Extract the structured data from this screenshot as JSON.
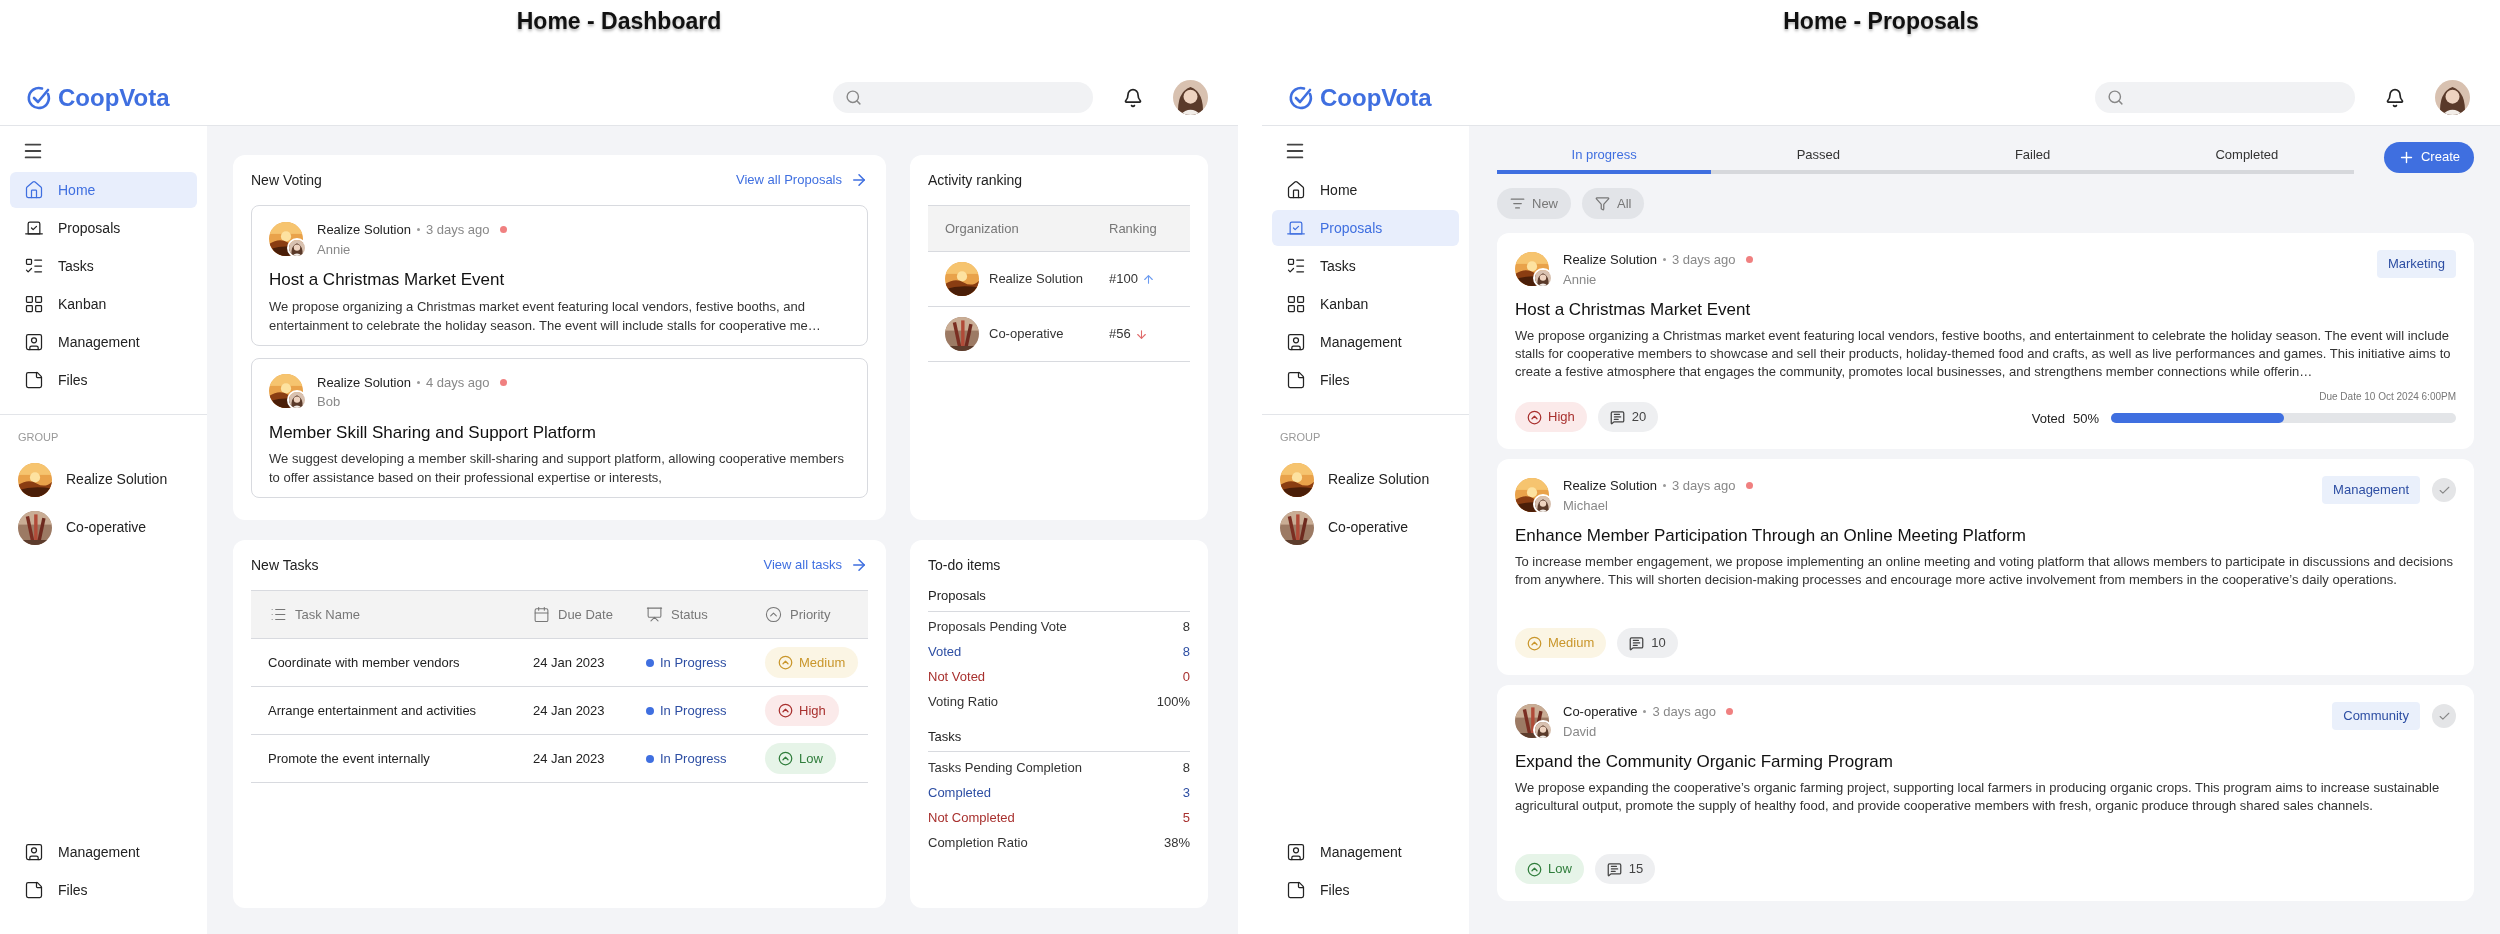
{
  "dashboard": {
    "caption": "Home - Dashboard",
    "brand": "CoopVota",
    "sidebar": {
      "items": [
        {
          "label": "Home",
          "selected": true
        },
        {
          "label": "Proposals",
          "selected": false
        },
        {
          "label": "Tasks",
          "selected": false
        },
        {
          "label": "Kanban",
          "selected": false
        },
        {
          "label": "Management",
          "selected": false
        },
        {
          "label": "Files",
          "selected": false
        }
      ],
      "group_label": "GROUP",
      "groups": [
        {
          "name": "Realize Solution"
        },
        {
          "name": "Co-operative"
        }
      ],
      "bottom_items": [
        {
          "label": "Management"
        },
        {
          "label": "Files"
        }
      ]
    },
    "new_voting": {
      "title": "New Voting",
      "link": "View all Proposals",
      "items": [
        {
          "org": "Realize Solution",
          "time": "3 days ago",
          "unread": true,
          "author": "Annie",
          "title": "Host a Christmas Market Event",
          "body": "We propose organizing a Christmas market event featuring local vendors, festive booths, and entertainment to celebrate the holiday season. The event will include stalls for cooperative me…"
        },
        {
          "org": "Realize Solution",
          "time": "4 days ago",
          "unread": true,
          "author": "Bob",
          "title": "Member Skill Sharing and Support Platform",
          "body": "We suggest developing a member skill-sharing and support platform, allowing cooperative members to offer assistance based on their professional expertise or interests,"
        }
      ]
    },
    "activity_ranking": {
      "title": "Activity ranking",
      "columns": [
        "Organization",
        "Ranking"
      ],
      "rows": [
        {
          "organization": "Realize Solution",
          "ranking": "#100",
          "kind": "up"
        },
        {
          "organization": "Co-operative",
          "ranking": "#56",
          "kind": "down"
        }
      ]
    },
    "new_tasks": {
      "title": "New Tasks",
      "link": "View all tasks",
      "columns": [
        "Task Name",
        "Due Date",
        "Status",
        "Priority"
      ],
      "rows": [
        {
          "name": "Coordinate with member vendors",
          "due": "24 Jan 2023",
          "status": "In Progress",
          "priority": "Medium",
          "kind": "medium"
        },
        {
          "name": "Arrange entertainment and activities",
          "due": "24 Jan 2023",
          "status": "In Progress",
          "priority": "High",
          "kind": "high"
        },
        {
          "name": "Promote the event internally",
          "due": "24 Jan 2023",
          "status": "In Progress",
          "priority": "Low",
          "kind": "low"
        }
      ]
    },
    "todo": {
      "title": "To-do items",
      "sections": [
        {
          "title": "Proposals",
          "rows": [
            {
              "label": "Proposals Pending Vote",
              "value": "8",
              "kind": "plain"
            },
            {
              "label": "Voted",
              "value": "8",
              "kind": "positive"
            },
            {
              "label": "Not Voted",
              "value": "0",
              "kind": "negative"
            },
            {
              "label": "Voting Ratio",
              "value": "100%",
              "kind": "plain"
            }
          ]
        },
        {
          "title": "Tasks",
          "rows": [
            {
              "label": "Tasks Pending Completion",
              "value": "8",
              "kind": "plain"
            },
            {
              "label": "Completed",
              "value": "3",
              "kind": "positive"
            },
            {
              "label": "Not Completed",
              "value": "5",
              "kind": "negative"
            },
            {
              "label": "Completion Ratio",
              "value": "38%",
              "kind": "plain"
            }
          ]
        }
      ]
    }
  },
  "proposals_screen": {
    "caption": "Home - Proposals",
    "brand": "CoopVota",
    "sidebar": {
      "items": [
        {
          "label": "Home",
          "selected": false
        },
        {
          "label": "Proposals",
          "selected": true
        },
        {
          "label": "Tasks",
          "selected": false
        },
        {
          "label": "Kanban",
          "selected": false
        },
        {
          "label": "Management",
          "selected": false
        },
        {
          "label": "Files",
          "selected": false
        }
      ],
      "group_label": "GROUP",
      "groups": [
        {
          "name": "Realize Solution"
        },
        {
          "name": "Co-operative"
        }
      ],
      "bottom_items": [
        {
          "label": "Management"
        },
        {
          "label": "Files"
        }
      ]
    },
    "tabs": [
      {
        "label": "In progress",
        "selected": true
      },
      {
        "label": "Passed",
        "selected": false
      },
      {
        "label": "Failed",
        "selected": false
      },
      {
        "label": "Completed",
        "selected": false
      }
    ],
    "create_button": "Create",
    "filters": [
      "New",
      "All"
    ],
    "proposals": [
      {
        "org": "Realize Solution",
        "time": "3 days ago",
        "unread": true,
        "author": "Annie",
        "tag": "Marketing",
        "confirmable": false,
        "title": "Host a Christmas Market Event",
        "body": "We propose organizing a Christmas market event featuring local vendors, festive booths, and entertainment to celebrate the holiday season. The event will include stalls for cooperative members to showcase and sell their products, holiday-themed food and crafts, as well as live performances and games. This initiative aims to create a festive atmosphere that engages the community, promotes local businesses, and strengthens member connections while offerin…",
        "priority": "High",
        "kind": "high",
        "comments": "20",
        "vote": {
          "due": "Due Date 10 Oct 2024 6:00PM",
          "label": "Voted",
          "percent": "50%",
          "level": 0.5
        }
      },
      {
        "org": "Realize Solution",
        "time": "3 days ago",
        "unread": true,
        "author": "Michael",
        "tag": "Management",
        "confirmable": true,
        "title": "Enhance Member Participation Through an Online Meeting Platform",
        "body": "To increase member engagement, we propose implementing an online meeting and voting platform that allows members to participate in discussions and decisions from anywhere. This will shorten decision-making processes and encourage more active involvement from members in the cooperative’s daily operations.",
        "priority": "Medium",
        "kind": "medium",
        "comments": "10"
      },
      {
        "org": "Co-operative",
        "time": "3 days ago",
        "unread": true,
        "author": "David",
        "tag": "Community",
        "confirmable": true,
        "title": "Expand the Community Organic Farming Program",
        "body": "We propose expanding the cooperative’s organic farming project, supporting local farmers in producing organic crops. This program aims to increase sustainable agricultural output, promote the supply of healthy food, and provide cooperative members with fresh, organic produce through shared sales channels.",
        "priority": "Low",
        "kind": "low",
        "comments": "15"
      }
    ]
  }
}
